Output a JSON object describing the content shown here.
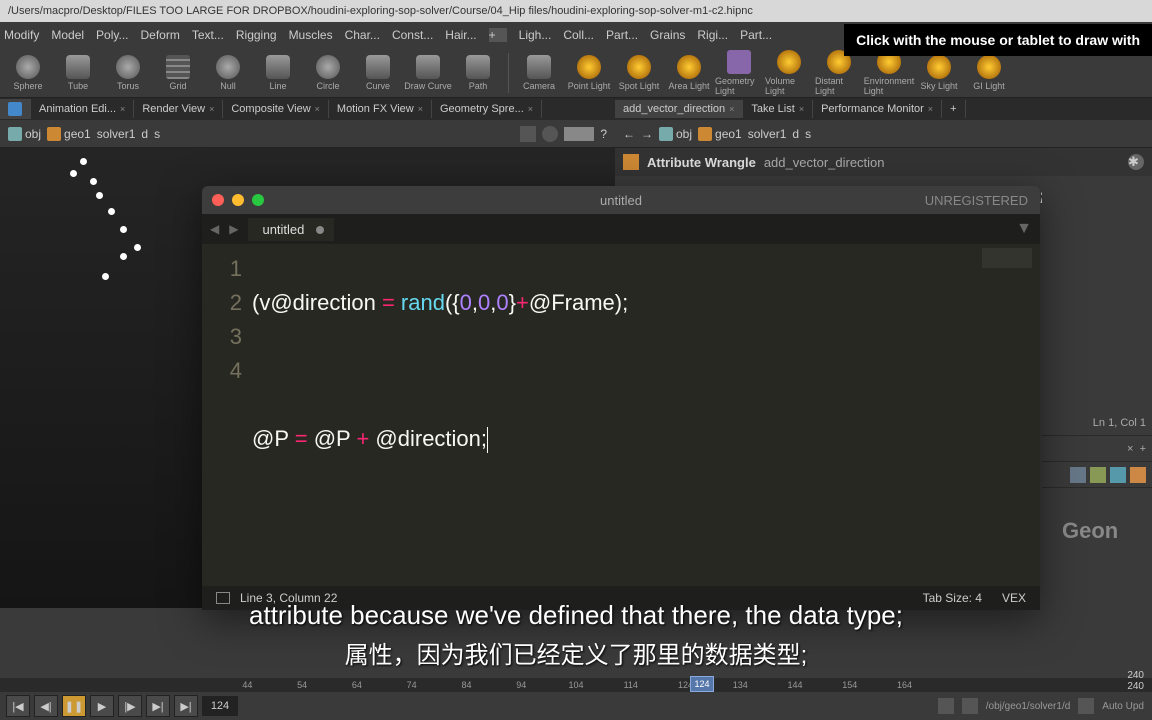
{
  "titlebar": "/Users/macpro/Desktop/FILES TOO LARGE FOR DROPBOX/houdini-exploring-sop-solver/Course/04_Hip files/houdini-exploring-sop-solver-m1-c2.hipnc",
  "tooltip": "Click with the mouse or tablet to draw with",
  "menu": [
    "Modify",
    "Model",
    "Poly...",
    "Deform",
    "Text...",
    "Rigging",
    "Muscles",
    "Char...",
    "Const...",
    "Hair...",
    "",
    "Ligh...",
    "Coll...",
    "Part...",
    "Grains",
    "Rigi...",
    "Part..."
  ],
  "shelf": [
    {
      "label": "Sphere",
      "icon": "circle"
    },
    {
      "label": "Tube",
      "icon": "cylinder"
    },
    {
      "label": "Torus",
      "icon": "circle"
    },
    {
      "label": "Grid",
      "icon": "grid"
    },
    {
      "label": "Null",
      "icon": "circle"
    },
    {
      "label": "Line",
      "icon": "cylinder"
    },
    {
      "label": "Circle",
      "icon": "circle"
    },
    {
      "label": "Curve",
      "icon": "cylinder"
    },
    {
      "label": "Draw Curve",
      "icon": "cylinder"
    },
    {
      "label": "Path",
      "icon": "cylinder"
    }
  ],
  "shelf2": [
    {
      "label": "Camera",
      "icon": "cylinder"
    },
    {
      "label": "Point Light",
      "icon": "light"
    },
    {
      "label": "Spot Light",
      "icon": "light"
    },
    {
      "label": "Area Light",
      "icon": "light"
    },
    {
      "label": "Geometry Light",
      "icon": "purple"
    },
    {
      "label": "Volume Light",
      "icon": "light"
    },
    {
      "label": "Distant Light",
      "icon": "light"
    },
    {
      "label": "Environment Light",
      "icon": "light"
    },
    {
      "label": "Sky Light",
      "icon": "light"
    },
    {
      "label": "GI Light",
      "icon": "light"
    }
  ],
  "tabs_left": [
    "Animation Edi...",
    "Render View",
    "Composite View",
    "Motion FX View",
    "Geometry Spre..."
  ],
  "tabs_right": [
    "add_vector_direction",
    "Take List",
    "Performance Monitor"
  ],
  "breadcrumb_left": [
    "obj",
    "geo1",
    "solver1",
    "d",
    "s"
  ],
  "breadcrumb_right": [
    "obj",
    "geo1",
    "solver1",
    "d",
    "s"
  ],
  "node": {
    "type": "Attribute Wrangle",
    "name": "add_vector_direction"
  },
  "editor": {
    "title": "untitled",
    "unregistered": "UNREGISTERED",
    "tab": "untitled",
    "lines": [
      "1",
      "2",
      "3",
      "4"
    ],
    "status_pos": "Line 3, Column 22",
    "status_tab": "Tab Size: 4",
    "status_lang": "VEX",
    "code": {
      "l1_a": "(v@direction ",
      "l1_eq": "=",
      "l1_b": " ",
      "l1_fn": "rand",
      "l1_c": "({",
      "l1_n1": "0",
      "l1_cm1": ",",
      "l1_n2": "0",
      "l1_cm2": ",",
      "l1_n3": "0",
      "l1_d": "}",
      "l1_plus": "+",
      "l1_e": "@Frame);",
      "l3_a": "@P ",
      "l3_eq": "=",
      "l3_b": " @P ",
      "l3_plus": "+",
      "l3_c": " @direction;"
    }
  },
  "right_panel": {
    "cursor": "Ln 1, Col 1",
    "geon": "Geon"
  },
  "subtitle_en": "attribute because we've defined that there, the data type;",
  "subtitle_cn": "属性，因为我们已经定义了那里的数据类型;",
  "timeline": {
    "ticks": [
      "44",
      "54",
      "64",
      "74",
      "84",
      "94",
      "104",
      "114",
      "124",
      "134",
      "144",
      "154",
      "164"
    ],
    "marker": "124",
    "right_top": "240",
    "right_bot": "240"
  },
  "playbar": {
    "frame": "124"
  },
  "statusbar": {
    "path": "/obj/geo1/solver1/d",
    "auto": "Auto Upd"
  }
}
